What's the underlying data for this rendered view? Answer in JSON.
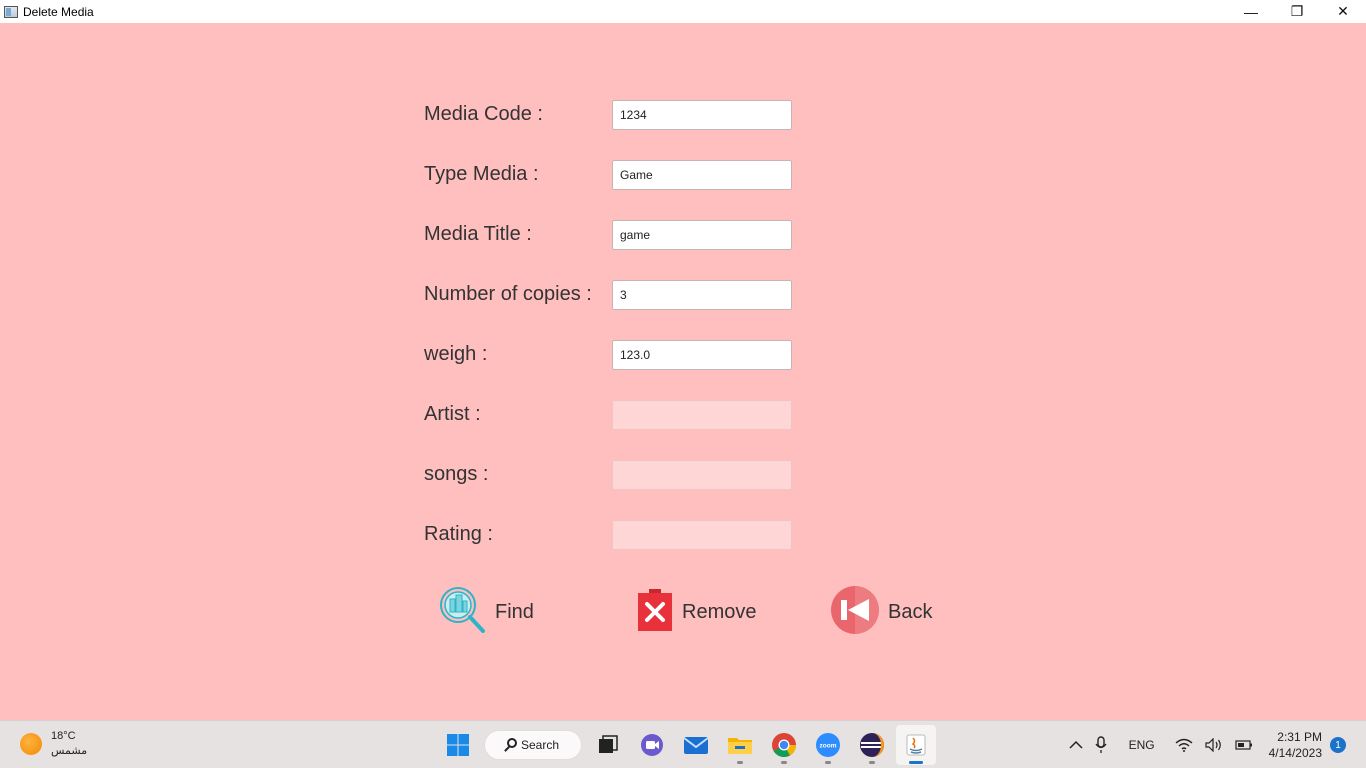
{
  "window": {
    "title": "Delete Media",
    "minimize_glyph": "—",
    "restore_glyph": "❐",
    "close_glyph": "✕"
  },
  "form": {
    "media_code": {
      "label": "Media Code :",
      "value": "1234"
    },
    "type_media": {
      "label": "Type Media :",
      "value": "Game"
    },
    "media_title": {
      "label": "Media Title :",
      "value": "game"
    },
    "copies": {
      "label": "Number of copies :",
      "value": "3"
    },
    "weigh": {
      "label": "weigh :",
      "value": "123.0"
    },
    "artist": {
      "label": "Artist :",
      "value": ""
    },
    "songs": {
      "label": "songs :",
      "value": ""
    },
    "rating": {
      "label": "Rating :",
      "value": ""
    }
  },
  "actions": {
    "find": "Find",
    "remove": "Remove",
    "back": "Back"
  },
  "taskbar": {
    "weather_temp": "18°C",
    "weather_desc": "مشمس",
    "search_label": "Search",
    "language": "ENG",
    "time": "2:31 PM",
    "date": "4/14/2023",
    "notifications": "1",
    "zoom_label": "zoom",
    "pinned_icons": [
      "windows-start-icon",
      "task-view-icon",
      "chat-icon",
      "mail-icon",
      "file-explorer-icon",
      "chrome-icon",
      "zoom-icon",
      "eclipse-icon",
      "java-icon"
    ]
  },
  "colors": {
    "background": "#ffbfbf",
    "disabled_field": "#ffd6d6",
    "remove_red": "#e8313b",
    "back_pink": "#e9676c",
    "find_teal": "#2bb5c8"
  }
}
